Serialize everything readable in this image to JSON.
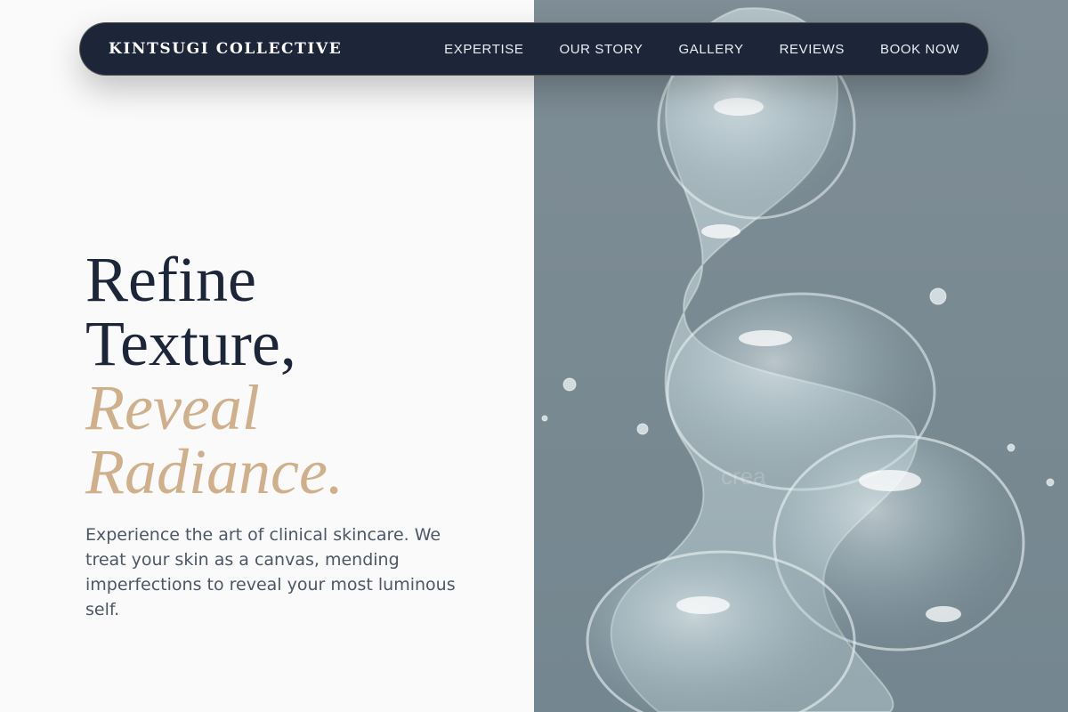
{
  "nav": {
    "brand": "KINTSUGI COLLECTIVE",
    "links": [
      "EXPERTISE",
      "OUR STORY",
      "GALLERY",
      "REVIEWS",
      "BOOK NOW"
    ]
  },
  "hero": {
    "headline_line1": "Refine",
    "headline_line2": "Texture,",
    "headline_line3": "Reveal",
    "headline_line4": "Radiance.",
    "subtext": "Experience the art of clinical skincare. We treat your skin as a canvas, mending imperfections to reveal your most luminous self.",
    "image_watermark": "crea"
  },
  "colors": {
    "navy": "#1d2639",
    "gold": "#cfb08b",
    "page_bg": "#fafafa",
    "panel_bg": "#7e8d96"
  }
}
